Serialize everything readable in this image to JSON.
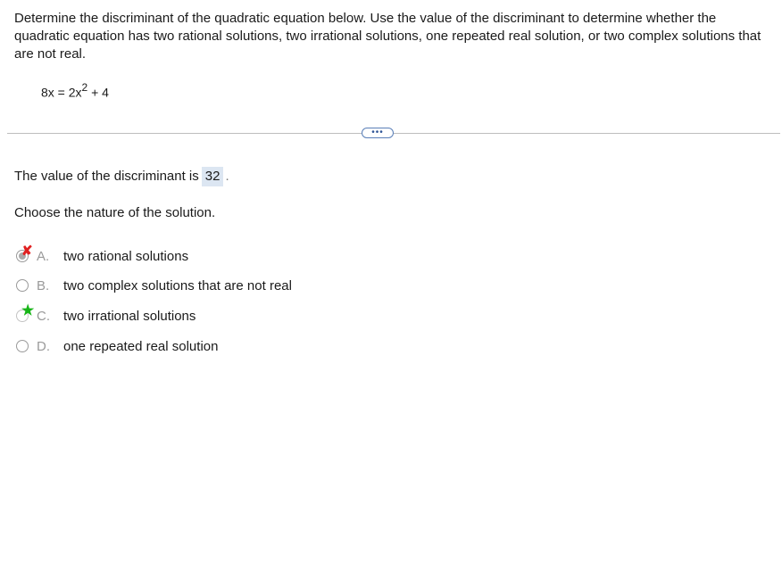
{
  "question": {
    "text": "Determine the discriminant of the quadratic equation below. Use the value of the discriminant to determine whether the quadratic equation has two rational solutions, two irrational solutions, one repeated real solution, or two complex solutions that are not real.",
    "equation": {
      "lhs": "8x = 2x",
      "exponent": "2",
      "rhs": " + 4"
    }
  },
  "more_button_label": "•••",
  "discriminant": {
    "label": "The value of the discriminant is",
    "value": "32",
    "suffix": "."
  },
  "prompt": "Choose the nature of the solution.",
  "choices": [
    {
      "letter": "A.",
      "text": "two rational solutions",
      "selected": true,
      "mark": "incorrect-x"
    },
    {
      "letter": "B.",
      "text": "two complex solutions that are not real",
      "selected": false,
      "mark": ""
    },
    {
      "letter": "C.",
      "text": "two irrational solutions",
      "selected": false,
      "mark": "correct-star"
    },
    {
      "letter": "D.",
      "text": "one repeated real solution",
      "selected": false,
      "mark": ""
    }
  ],
  "marks": {
    "incorrect": "✘",
    "correct": "★"
  },
  "colors": {
    "incorrect": "#e02020",
    "correct": "#17b517",
    "answer_box": "#dce6f2"
  }
}
